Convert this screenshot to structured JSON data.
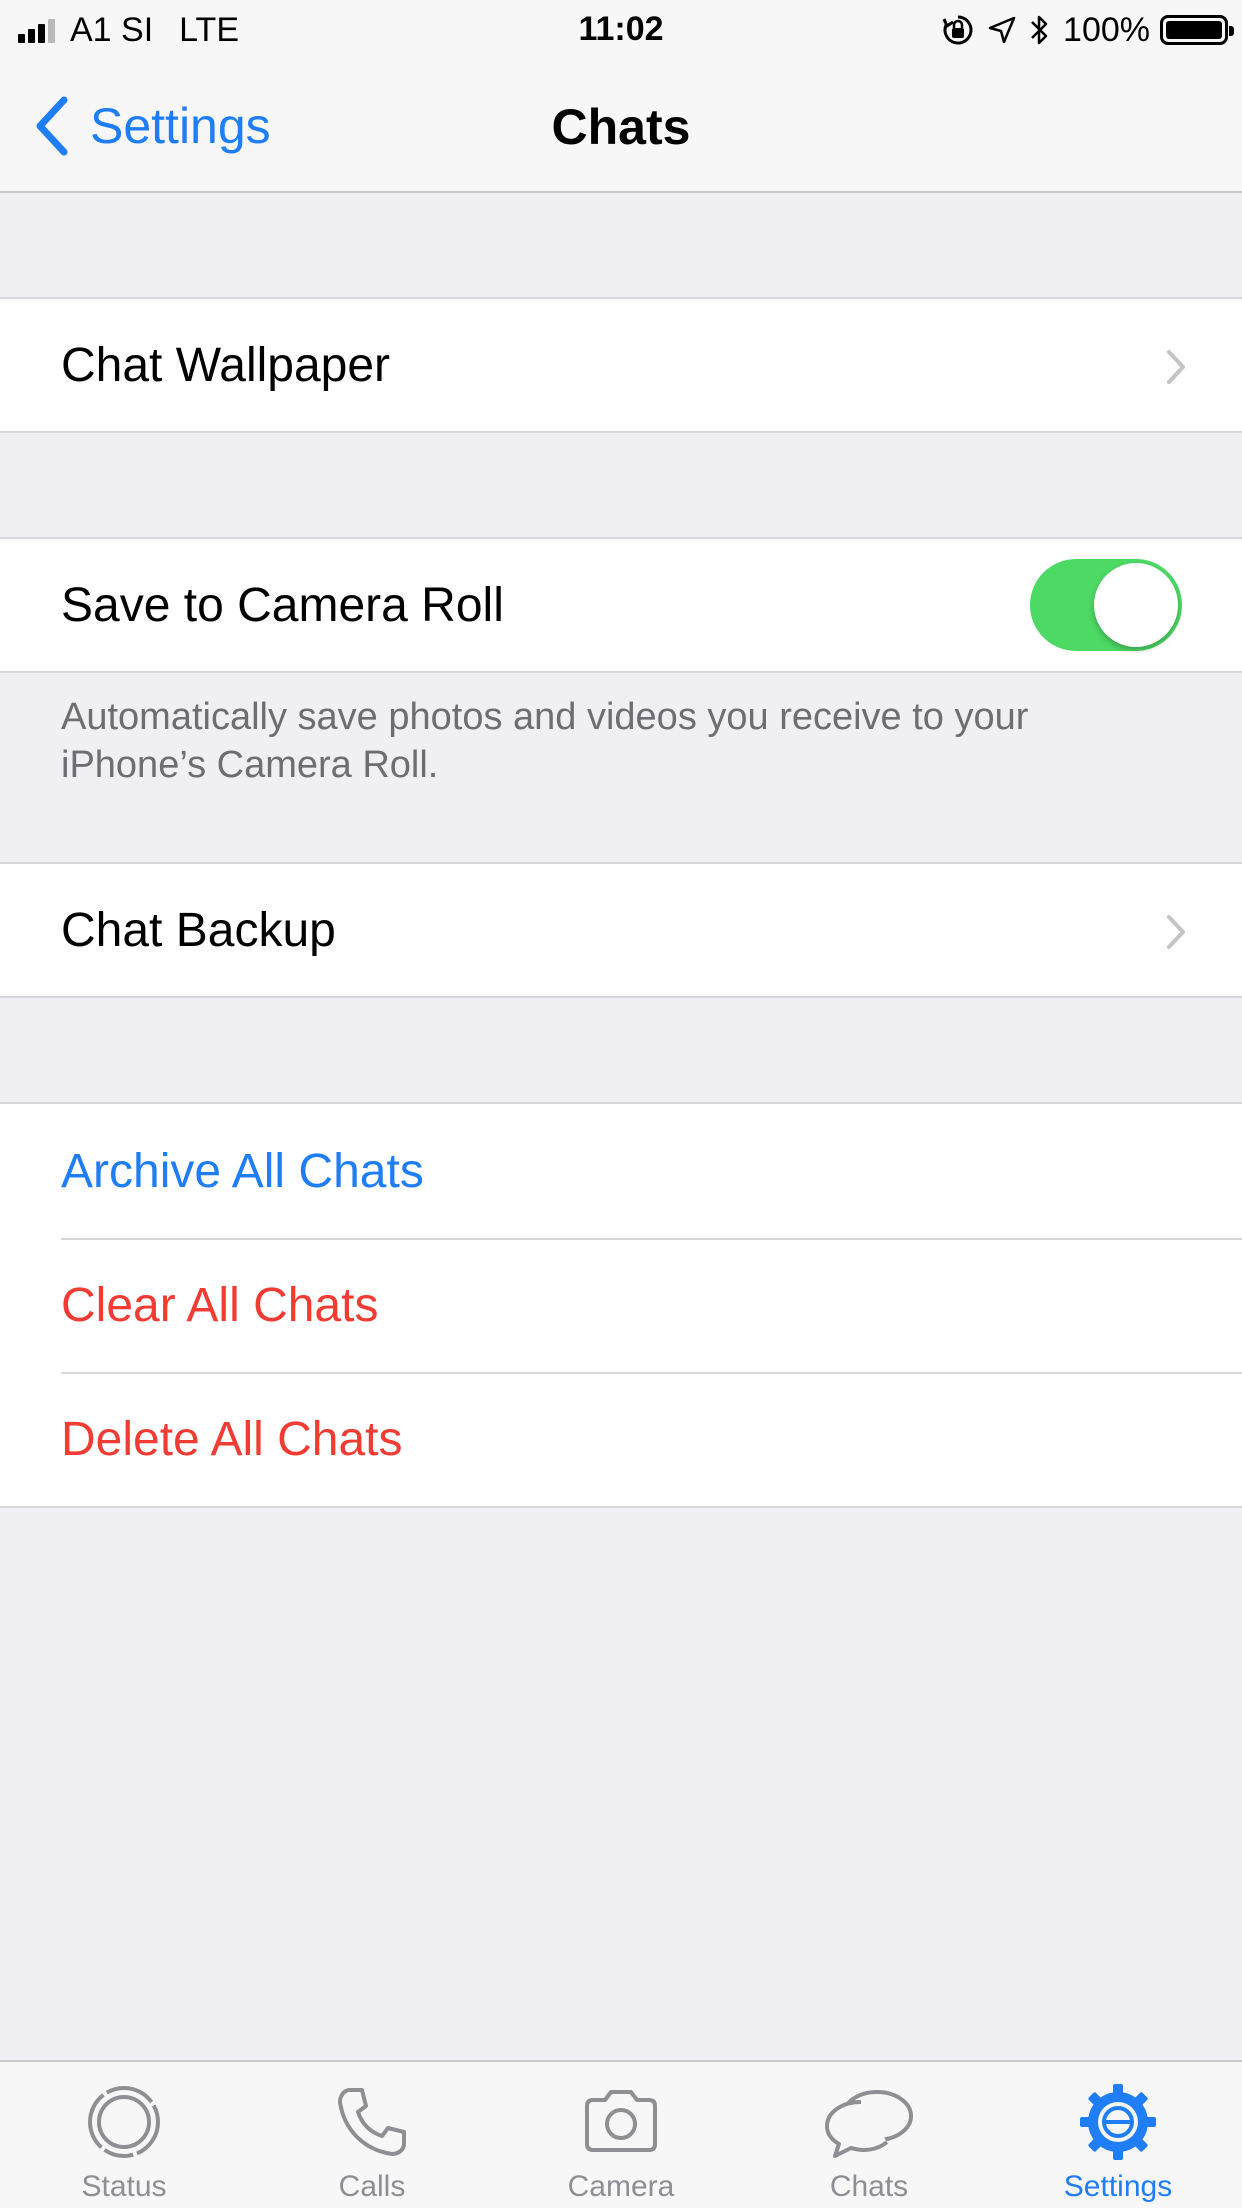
{
  "status_bar": {
    "carrier": "A1 SI",
    "network": "LTE",
    "time": "11:02",
    "battery": "100%"
  },
  "nav": {
    "back_label": "Settings",
    "title": "Chats"
  },
  "sections": {
    "wallpaper": {
      "label": "Chat Wallpaper"
    },
    "camera_roll": {
      "label": "Save to Camera Roll",
      "enabled": true,
      "footnote": "Automatically save photos and videos you receive to your iPhone’s Camera Roll."
    },
    "backup": {
      "label": "Chat Backup"
    },
    "actions": {
      "archive": "Archive All Chats",
      "clear": "Clear All Chats",
      "delete": "Delete All Chats"
    }
  },
  "tabs": [
    {
      "label": "Status",
      "icon": "status-icon"
    },
    {
      "label": "Calls",
      "icon": "phone-icon"
    },
    {
      "label": "Camera",
      "icon": "camera-icon"
    },
    {
      "label": "Chats",
      "icon": "chat-bubbles-icon"
    },
    {
      "label": "Settings",
      "icon": "gear-icon",
      "active": true
    }
  ],
  "colors": {
    "accent": "#1f7ef5",
    "destructive": "#f03c33",
    "toggle_on": "#4cd964",
    "background": "#efeff4"
  }
}
